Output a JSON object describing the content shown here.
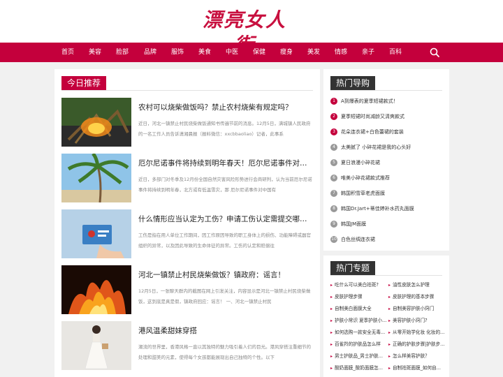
{
  "header": {
    "logo": "漂亮女人街"
  },
  "nav": {
    "items": [
      "首页",
      "美容",
      "脸部",
      "品牌",
      "服饰",
      "美食",
      "中医",
      "保健",
      "瘦身",
      "美发",
      "情感",
      "亲子",
      "百科"
    ],
    "search_icon": "search-icon"
  },
  "recommend": {
    "heading": "今日推荐",
    "articles": [
      {
        "title": "农村可以烧柴做饭吗？禁止农村烧柴有规定吗？",
        "desc": "近日，河北一镇禁止村民烧柴做饭通知书传遍节前的消息。12月5日，满城镇人民政府的一名工作人员告诉潇湘晨报（报料微信：xxcbbaoliao）记者，此事系",
        "image": "burning-branches"
      },
      {
        "title": "厄尔尼诺事件将持续到明年春天！厄尔尼诺事件对中国有...",
        "desc": "近日，多部门对冬季及12月份全国自然灾害风险形势进行会商研判，认为当前厄尔尼诺事件将持续到明年春，北方或有低温雪灾，那 厄尔尼诺事件对中国有",
        "image": "palm-tree"
      },
      {
        "title": "什么情形应当认定为工伤？申请工伤认定需提交哪些材料？",
        "desc": "工伤是指在用人单位工作期间，因工作原因导致的职工身体上的损伤、功能障碍或器官组织的异常，以及因此导致的生命体征的异常。工伤的认定和赔偿往",
        "image": "hand-card"
      },
      {
        "title": "河北一镇禁止村民烧柴做饭？镇政府：谣言！",
        "desc": "12月5日，一张聊天群内的截图在网上引发关注，内容显示是河北一镇禁止村民烧柴做饭，这到底是真是假，镇政府回应：谣言！ 一、河北一镇禁止村民",
        "image": "fire"
      },
      {
        "title": "港风温柔甜妹穿搭",
        "desc": "潮流的世界里，香港风格一直以其独特的魅力吸引着人们的目光。港风穿搭注重细节的处理和甜美的元素，使得每个女孩都能展现出自己独特的个性。以下",
        "image": "woman-dress"
      }
    ]
  },
  "hot_guide": {
    "heading": "热门导购",
    "items": [
      {
        "num": "1",
        "text": "A到爆表的夏季短裙款式！"
      },
      {
        "num": "2",
        "text": "夏季短裙时尚减龄又清爽款式"
      },
      {
        "num": "3",
        "text": "花朵连衣裙+白色蕾裙的套装"
      },
      {
        "num": "4",
        "text": "太美腻了 小碎花裙是我的心头好"
      },
      {
        "num": "5",
        "text": "夏日浪漫小碎花裙"
      },
      {
        "num": "6",
        "text": "唯美小碎花裙款式推荐"
      },
      {
        "num": "7",
        "text": "韩国积雪草老虎面膜"
      },
      {
        "num": "8",
        "text": "韩国Dr.Jart+蒂佳婷补水药丸面膜"
      },
      {
        "num": "9",
        "text": "韩国JM面膜"
      },
      {
        "num": "10",
        "text": "白色丝绸连衣裙"
      }
    ]
  },
  "hot_topics": {
    "heading": "热门专题",
    "items": [
      "吃什么可以美白祛斑?",
      "油性皮肤怎么护理",
      "皮肤护理步骤",
      "皮肤护理的基本步骤",
      "自制美白面膜大全",
      "自制美容护肤小窍门",
      "护肤小常识 夏季护肤小...",
      "美容护肤小窍门?",
      "如何选购一款安全无毒...",
      "从零开始学化妆 化妆的...",
      "百雀羚的护肤品怎么样",
      "正确的护肤步骤|护肤步...",
      "男士护肤品_男士护肤...",
      "怎么样美容护肤？",
      "酸奶面膜_酸奶面膜怎...",
      "自制祛斑面膜_如何自..."
    ]
  },
  "colors": {
    "brand": "#c4003c",
    "dark": "#333333"
  }
}
